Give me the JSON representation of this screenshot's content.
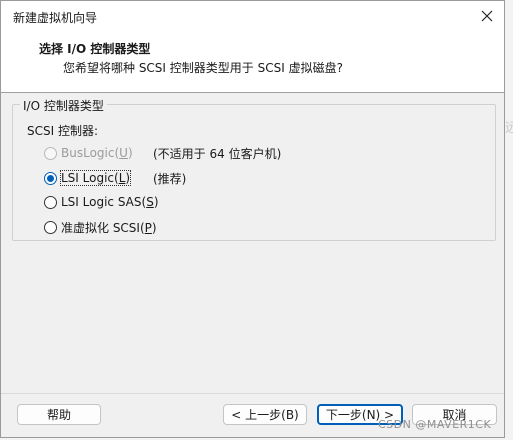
{
  "window": {
    "title": "新建虚拟机向导"
  },
  "header": {
    "title": "选择 I/O 控制器类型",
    "subtitle": "您希望将哪种 SCSI 控制器类型用于 SCSI 虚拟磁盘?"
  },
  "group": {
    "legend": "I/O 控制器类型",
    "scsi_label": "SCSI 控制器:",
    "options": [
      {
        "label": "BusLogic(",
        "mnemonic": "U",
        "suffix": ")",
        "note": "(不适用于 64 位客户机)",
        "checked": false,
        "disabled": true
      },
      {
        "label": "LSI Logic(",
        "mnemonic": "L",
        "suffix": ")",
        "note": "(推荐)",
        "checked": true,
        "disabled": false
      },
      {
        "label": "LSI Logic SAS(",
        "mnemonic": "S",
        "suffix": ")",
        "note": "",
        "checked": false,
        "disabled": false
      },
      {
        "label": "准虚拟化 SCSI(",
        "mnemonic": "P",
        "suffix": ")",
        "note": "",
        "checked": false,
        "disabled": false
      }
    ]
  },
  "buttons": {
    "help": "帮助",
    "back": "< 上一步(B)",
    "next": "下一步(N) >",
    "cancel": "取消"
  },
  "background": {
    "side_char": "远"
  },
  "watermark": "CSDN @MAVER1CK",
  "colors": {
    "accent": "#005fb8",
    "dialog_bg": "#f0f0f0"
  }
}
